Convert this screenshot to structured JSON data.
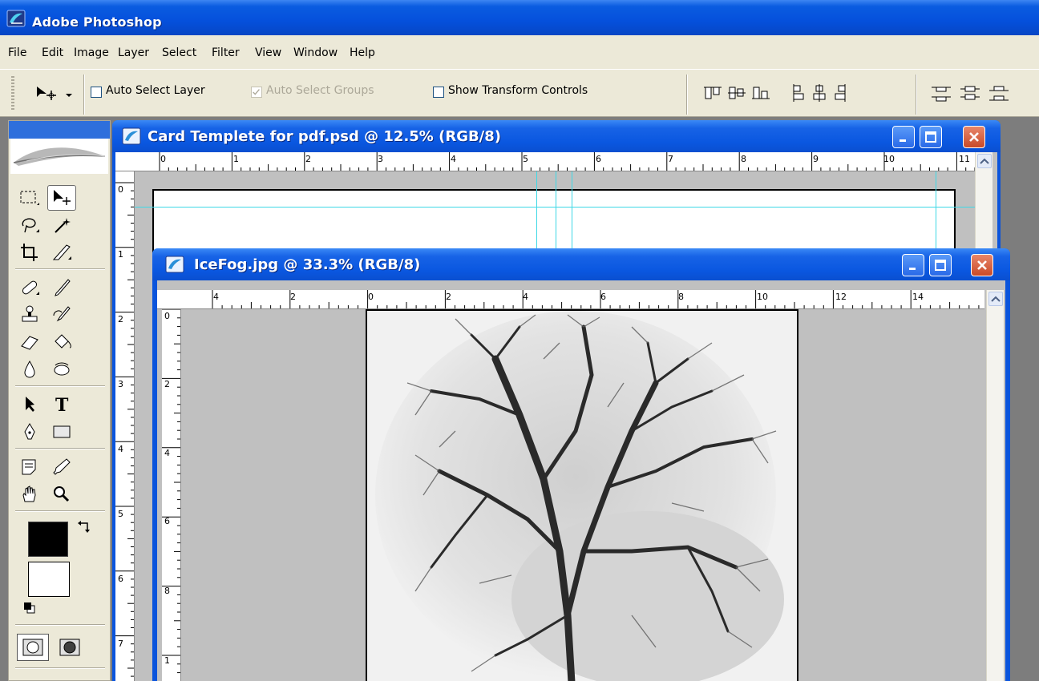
{
  "app": {
    "title": "Adobe Photoshop"
  },
  "menu": [
    "File",
    "Edit",
    "Image",
    "Layer",
    "Select",
    "Filter",
    "View",
    "Window",
    "Help"
  ],
  "options": {
    "auto_select_layer": "Auto Select Layer",
    "auto_select_groups": "Auto Select Groups",
    "show_transform_controls": "Show Transform Controls"
  },
  "colors": {
    "foreground": "#000000",
    "background": "#ffffff",
    "guide": "#3fd8e6",
    "titlebar": "#0a57e0"
  },
  "windows": {
    "card": {
      "title": "Card Templete for pdf.psd @ 12.5% (RGB/8)",
      "hruler": [
        "0",
        "1",
        "2",
        "3",
        "4",
        "5",
        "6",
        "7",
        "8",
        "9",
        "10",
        "11"
      ],
      "vruler": [
        "0",
        "1",
        "2",
        "3",
        "4",
        "5",
        "6",
        "7"
      ]
    },
    "icefog": {
      "title": "IceFog.jpg @ 33.3% (RGB/8)",
      "hruler": [
        "4",
        "2",
        "0",
        "2",
        "4",
        "6",
        "8",
        "10",
        "12",
        "14"
      ],
      "vruler": [
        "0",
        "2",
        "4",
        "6",
        "8",
        "1"
      ]
    }
  }
}
